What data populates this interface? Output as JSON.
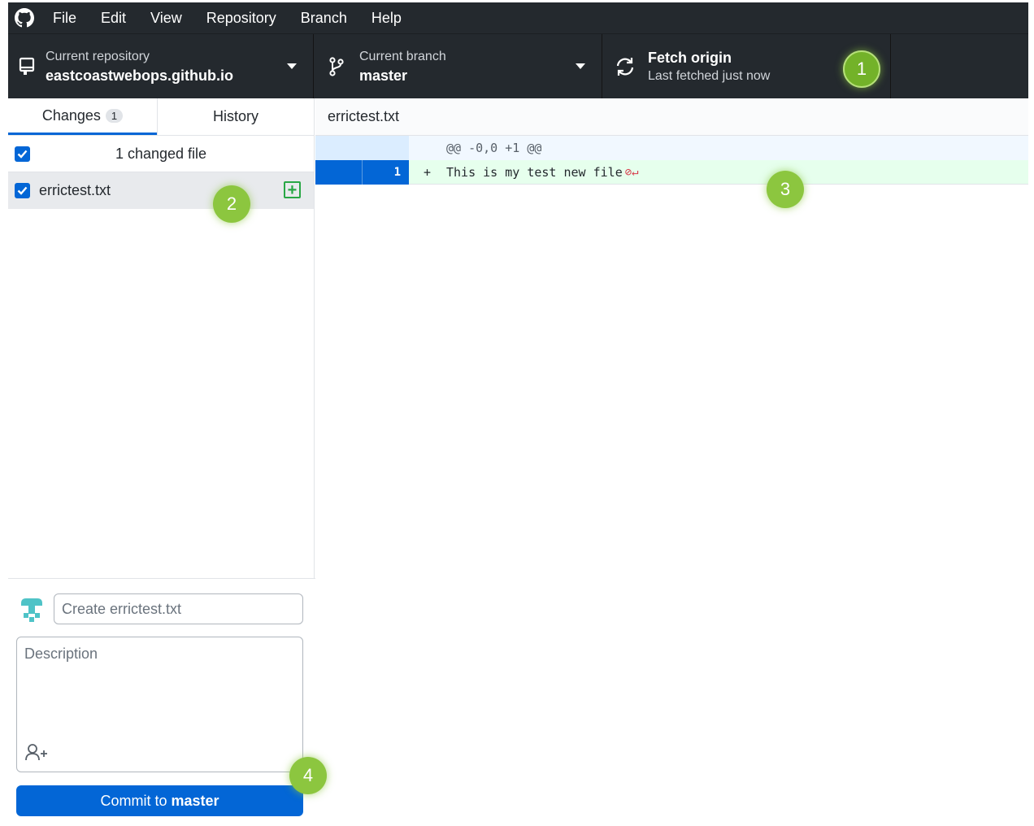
{
  "menu": {
    "items": [
      "File",
      "Edit",
      "View",
      "Repository",
      "Branch",
      "Help"
    ]
  },
  "toolbar": {
    "repo_label": "Current repository",
    "repo_value": "eastcoastwebops.github.io",
    "branch_label": "Current branch",
    "branch_value": "master",
    "fetch_label": "Fetch origin",
    "fetch_status": "Last fetched just now"
  },
  "tabs": {
    "changes_label": "Changes",
    "changes_count": "1",
    "history_label": "History"
  },
  "changes": {
    "summary": "1 changed file",
    "files": [
      {
        "name": "errictest.txt",
        "status": "added"
      }
    ]
  },
  "commit": {
    "summary_placeholder": "Create errictest.txt",
    "description_placeholder": "Description",
    "button_prefix": "Commit to",
    "button_branch": "master"
  },
  "diff": {
    "file_name": "errictest.txt",
    "hunk_header": "@@ -0,0 +1 @@",
    "lines": [
      {
        "new_number": "1",
        "marker": "+",
        "text": "This is my test new file"
      }
    ]
  },
  "callouts": [
    "1",
    "2",
    "3",
    "4"
  ],
  "colors": {
    "toolbar_bg": "#24292e",
    "accent_blue": "#0366d6",
    "added_green": "#28a745",
    "callout_green": "#8cc63f"
  }
}
